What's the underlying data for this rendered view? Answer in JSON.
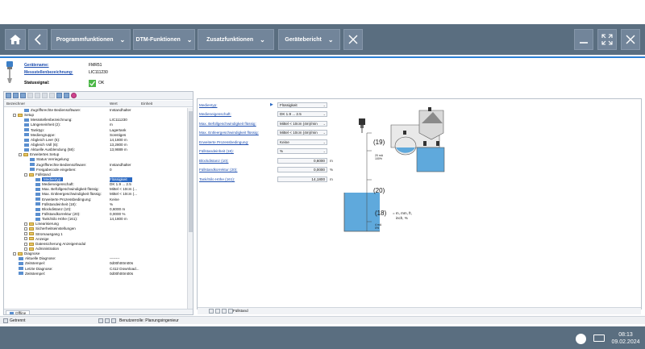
{
  "toolbar": {
    "menus": [
      {
        "label": "Programmfunktionen"
      },
      {
        "label": "DTM-Funktionen"
      },
      {
        "label": "Zusatzfunktionen"
      },
      {
        "label": "Gerätebericht"
      }
    ]
  },
  "device": {
    "name_label": "Gerätename:",
    "name_value": "FMR51",
    "tag_label": "Messstellenbezeichnung:",
    "tag_value": "LIC111230",
    "status_label": "Statussignal:",
    "status_value": "OK"
  },
  "left_panel": {
    "columns": {
      "name": "Bezeichner",
      "value": "Wert",
      "unit": "Einheit"
    },
    "rows": [
      {
        "name": "Zugriffsrechte Bediensoftware:",
        "value": "Instandhalter",
        "indent": 3,
        "type": "param"
      },
      {
        "name": "Setup",
        "value": "",
        "indent": 1,
        "type": "folder"
      },
      {
        "name": "Messstellenbezeichnung:",
        "value": "LIC111230",
        "indent": 3,
        "type": "param"
      },
      {
        "name": "Längeneinheit (2):",
        "value": "m",
        "indent": 3,
        "type": "param"
      },
      {
        "name": "Tanktyp:",
        "value": "Lagertank",
        "indent": 3,
        "type": "param"
      },
      {
        "name": "Mediengruppe:",
        "value": "Sonstiges",
        "indent": 3,
        "type": "param"
      },
      {
        "name": "Abgleich Leer (5):",
        "value": "14,1800 m",
        "indent": 3,
        "type": "param"
      },
      {
        "name": "Abgleich Voll (6):",
        "value": "13,2800 m",
        "indent": 3,
        "type": "param"
      },
      {
        "name": "Aktuelle Ausblendung (58):",
        "value": "13,9889 m",
        "indent": 3,
        "type": "param"
      },
      {
        "name": "Erweitertes Setup",
        "value": "",
        "indent": 2,
        "type": "folder"
      },
      {
        "name": "Status Verriegelung:",
        "value": "",
        "indent": 4,
        "type": "param"
      },
      {
        "name": "Zugriffsrechte Bediensoftware:",
        "value": "Instandhalter",
        "indent": 4,
        "type": "param"
      },
      {
        "name": "Freigabecode eingeben:",
        "value": "0",
        "indent": 4,
        "type": "param"
      },
      {
        "name": "Füllstand",
        "value": "",
        "indent": 3,
        "type": "folder"
      },
      {
        "name": "Medientyp:",
        "value": "Flüssigkeit",
        "indent": 5,
        "type": "param",
        "selected": true
      },
      {
        "name": "Medieneigenschaft:",
        "value": "DK 1.9 ... 2.5",
        "indent": 5,
        "type": "param"
      },
      {
        "name": "Max. Befüllgeschwindigkeit flüssig:",
        "value": "Mittel < 10cm (...",
        "indent": 5,
        "type": "param"
      },
      {
        "name": "Max. Entleergeschwindigkeit flüssig:",
        "value": "Mittel < 10cm (...",
        "indent": 5,
        "type": "param"
      },
      {
        "name": "Erweiterte Prozessbedingung:",
        "value": "Keine",
        "indent": 5,
        "type": "param"
      },
      {
        "name": "Füllstandeinheit (18):",
        "value": "%",
        "indent": 5,
        "type": "param"
      },
      {
        "name": "Blockdistanz (10):",
        "value": "0,6000 m",
        "indent": 5,
        "type": "param"
      },
      {
        "name": "Füllstandkorrektur (20):",
        "value": "0,0000 %",
        "indent": 5,
        "type": "param"
      },
      {
        "name": "Tank/Silo Höhe (161):",
        "value": "14,1800 m",
        "indent": 5,
        "type": "param"
      },
      {
        "name": "Linearisierung",
        "value": "",
        "indent": 3,
        "type": "folder"
      },
      {
        "name": "Sicherheitseinstellungen",
        "value": "",
        "indent": 3,
        "type": "folder"
      },
      {
        "name": "Stromausgang 1",
        "value": "",
        "indent": 3,
        "type": "folder"
      },
      {
        "name": "Anzeige",
        "value": "",
        "indent": 3,
        "type": "folder"
      },
      {
        "name": "Datensicherung Anzeigemodul",
        "value": "",
        "indent": 3,
        "type": "folder"
      },
      {
        "name": "Administration",
        "value": "",
        "indent": 3,
        "type": "folder"
      },
      {
        "name": "Diagnose",
        "value": "",
        "indent": 1,
        "type": "folder"
      },
      {
        "name": "Aktuelle Diagnose:",
        "value": "--------",
        "indent": 2,
        "type": "param"
      },
      {
        "name": "Zeitstempel:",
        "value": "0d00h00m00s",
        "indent": 2,
        "type": "param"
      },
      {
        "name": "Letzte Diagnose:",
        "value": "C412 Download...",
        "indent": 2,
        "type": "param"
      },
      {
        "name": "Zeitstempel:",
        "value": "0d00h00m00s",
        "indent": 2,
        "type": "param"
      }
    ],
    "footer_tab": "Offline"
  },
  "right_panel": {
    "params": [
      {
        "label": "Medientyp:",
        "value": "Flüssigkeit",
        "kind": "select",
        "unit": ""
      },
      {
        "label": "Medieneigenschaft:",
        "value": "DK 1.9 ... 2.5",
        "kind": "select",
        "unit": ""
      },
      {
        "label": "Max. Befüllgeschwindigkeit flüssig:",
        "value": "Mittel < 10cm (4m)/min",
        "kind": "select",
        "unit": ""
      },
      {
        "label": "Max. Entleergeschwindigkeit flüssig:",
        "value": "Mittel < 10cm (4m)/min",
        "kind": "select",
        "unit": ""
      },
      {
        "label": "Erweiterte Prozessbedingung:",
        "value": "Keine",
        "kind": "select",
        "unit": ""
      },
      {
        "label": "Füllstandeinheit (18):",
        "value": "%",
        "kind": "select",
        "unit": ""
      },
      {
        "label": "Blockdistanz (10):",
        "value": "0,6000",
        "kind": "number",
        "unit": "m"
      },
      {
        "label": "Füllstandkorrektur (20):",
        "value": "0,0000",
        "kind": "number",
        "unit": "%"
      },
      {
        "label": "Tank/Silo Höhe (161):",
        "value": "14,1800",
        "kind": "number",
        "unit": "m"
      }
    ],
    "diagram": {
      "label_19": "(19)",
      "label_20": "(20)",
      "label_18": "(18)",
      "units_note_1": "= m, mm, ft,",
      "units_note_2": "inch, %",
      "mark_20mA": "20 mA",
      "mark_100": "100%",
      "mark_4mA": "4 mA",
      "mark_0": "0%"
    },
    "section_label": "Füllstand"
  },
  "statusbar": {
    "connection": "Getrennt",
    "role": "Benutzerrolle: Planungsingenieur"
  },
  "taskbar": {
    "time": "08:13",
    "date": "09.02.2024"
  }
}
